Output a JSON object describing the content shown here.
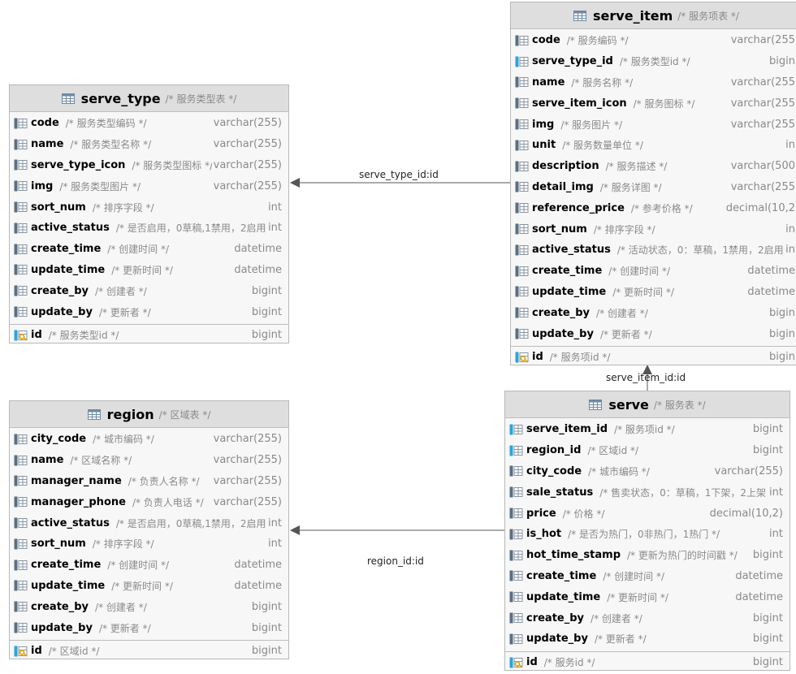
{
  "tables": {
    "serve_type": {
      "name": "serve_type",
      "comment": "/* 服务类型表 */",
      "columns": [
        {
          "name": "code",
          "comment": "/* 服务类型编码 */",
          "type": "varchar(255)"
        },
        {
          "name": "name",
          "comment": "/* 服务类型名称 */",
          "type": "varchar(255)"
        },
        {
          "name": "serve_type_icon",
          "comment": "/* 服务类型图标 */",
          "type": "varchar(255)"
        },
        {
          "name": "img",
          "comment": "/* 服务类型图片 */",
          "type": "varchar(255)"
        },
        {
          "name": "sort_num",
          "comment": "/* 排序字段 */",
          "type": "int"
        },
        {
          "name": "active_status",
          "comment": "/* 是否启用，0草稿,1禁用，2启用 */",
          "type": "int"
        },
        {
          "name": "create_time",
          "comment": "/* 创建时间 */",
          "type": "datetime"
        },
        {
          "name": "update_time",
          "comment": "/* 更新时间 */",
          "type": "datetime"
        },
        {
          "name": "create_by",
          "comment": "/* 创建者 */",
          "type": "bigint"
        },
        {
          "name": "update_by",
          "comment": "/* 更新者 */",
          "type": "bigint"
        }
      ],
      "pk": {
        "name": "id",
        "comment": "/* 服务类型id */",
        "type": "bigint"
      }
    },
    "serve_item": {
      "name": "serve_item",
      "comment": "/* 服务项表 */",
      "columns": [
        {
          "name": "code",
          "comment": "/* 服务编码 */",
          "type": "varchar(255"
        },
        {
          "name": "serve_type_id",
          "comment": "/* 服务类型id */",
          "type": "bigin",
          "fk": true
        },
        {
          "name": "name",
          "comment": "/* 服务名称 */",
          "type": "varchar(255"
        },
        {
          "name": "serve_item_icon",
          "comment": "/* 服务图标 */",
          "type": "varchar(255"
        },
        {
          "name": "img",
          "comment": "/* 服务图片 */",
          "type": "varchar(255"
        },
        {
          "name": "unit",
          "comment": "/* 服务数量单位 */",
          "type": "in"
        },
        {
          "name": "description",
          "comment": "/* 服务描述 */",
          "type": "varchar(500"
        },
        {
          "name": "detail_img",
          "comment": "/* 服务详图 */",
          "type": "varchar(255"
        },
        {
          "name": "reference_price",
          "comment": "/* 参考价格 */",
          "type": "decimal(10,2"
        },
        {
          "name": "sort_num",
          "comment": "/* 排序字段 */",
          "type": "in"
        },
        {
          "name": "active_status",
          "comment": "/* 活动状态，0：草稿，1禁用，2启用 */",
          "type": "in"
        },
        {
          "name": "create_time",
          "comment": "/* 创建时间 */",
          "type": "datetime"
        },
        {
          "name": "update_time",
          "comment": "/* 更新时间 */",
          "type": "datetime"
        },
        {
          "name": "create_by",
          "comment": "/* 创建者 */",
          "type": "bigin"
        },
        {
          "name": "update_by",
          "comment": "/* 更新者 */",
          "type": "bigin"
        }
      ],
      "pk": {
        "name": "id",
        "comment": "/* 服务项id */",
        "type": "bigin"
      }
    },
    "region": {
      "name": "region",
      "comment": "/* 区域表 */",
      "columns": [
        {
          "name": "city_code",
          "comment": "/* 城市编码 */",
          "type": "varchar(255)"
        },
        {
          "name": "name",
          "comment": "/* 区域名称 */",
          "type": "varchar(255)"
        },
        {
          "name": "manager_name",
          "comment": "/* 负责人名称 */",
          "type": "varchar(255)"
        },
        {
          "name": "manager_phone",
          "comment": "/* 负责人电话 */",
          "type": "varchar(255)"
        },
        {
          "name": "active_status",
          "comment": "/* 是否启用，0草稿,1禁用，2启用 */",
          "type": "int"
        },
        {
          "name": "sort_num",
          "comment": "/* 排序字段 */",
          "type": "int"
        },
        {
          "name": "create_time",
          "comment": "/* 创建时间 */",
          "type": "datetime"
        },
        {
          "name": "update_time",
          "comment": "/* 更新时间 */",
          "type": "datetime"
        },
        {
          "name": "create_by",
          "comment": "/* 创建者 */",
          "type": "bigint"
        },
        {
          "name": "update_by",
          "comment": "/* 更新者 */",
          "type": "bigint"
        }
      ],
      "pk": {
        "name": "id",
        "comment": "/* 区域id */",
        "type": "bigint"
      }
    },
    "serve": {
      "name": "serve",
      "comment": "/* 服务表 */",
      "columns": [
        {
          "name": "serve_item_id",
          "comment": "/* 服务项id */",
          "type": "bigint",
          "fk": true
        },
        {
          "name": "region_id",
          "comment": "/* 区域id */",
          "type": "bigint",
          "fk": true
        },
        {
          "name": "city_code",
          "comment": "/* 城市编码 */",
          "type": "varchar(255)"
        },
        {
          "name": "sale_status",
          "comment": "/* 售卖状态，0：草稿，1下架，2上架 */",
          "type": "int"
        },
        {
          "name": "price",
          "comment": "/* 价格 */",
          "type": "decimal(10,2)"
        },
        {
          "name": "is_hot",
          "comment": "/* 是否为热门，0非热门，1热门 */",
          "type": "int"
        },
        {
          "name": "hot_time_stamp",
          "comment": "/* 更新为热门的时间戳 */",
          "type": "bigint"
        },
        {
          "name": "create_time",
          "comment": "/* 创建时间 */",
          "type": "datetime"
        },
        {
          "name": "update_time",
          "comment": "/* 更新时间 */",
          "type": "datetime"
        },
        {
          "name": "create_by",
          "comment": "/* 创建者 */",
          "type": "bigint"
        },
        {
          "name": "update_by",
          "comment": "/* 更新者 */",
          "type": "bigint"
        }
      ],
      "pk": {
        "name": "id",
        "comment": "/* 服务id */",
        "type": "bigint"
      }
    }
  },
  "edges": {
    "serve_type_id": "serve_type_id:id",
    "serve_item_id": "serve_item_id:id",
    "region_id": "region_id:id"
  }
}
